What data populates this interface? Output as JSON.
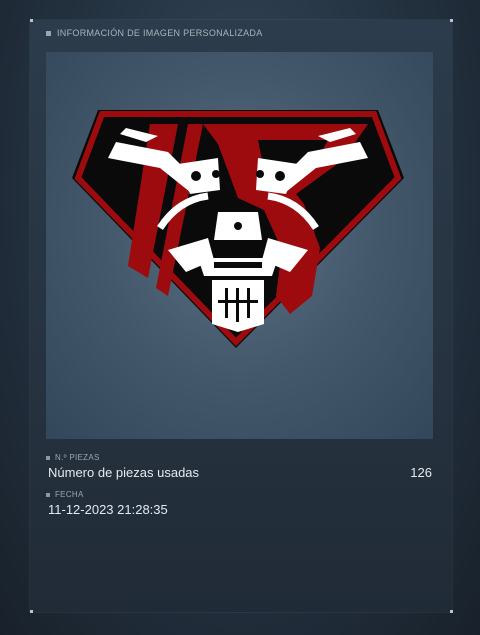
{
  "header": {
    "title": "INFORMACIÓN DE IMAGEN PERSONALIZADA"
  },
  "image": {
    "description_icon": "emblem-icon",
    "colors": {
      "red": "#9e0b0f",
      "black": "#0a0a0a",
      "white": "#ffffff"
    }
  },
  "pieces": {
    "caption": "N.º PIEZAS",
    "label": "Número de piezas usadas",
    "value": "126"
  },
  "date": {
    "caption": "FECHA",
    "value": "11-12-2023 21:28:35"
  }
}
